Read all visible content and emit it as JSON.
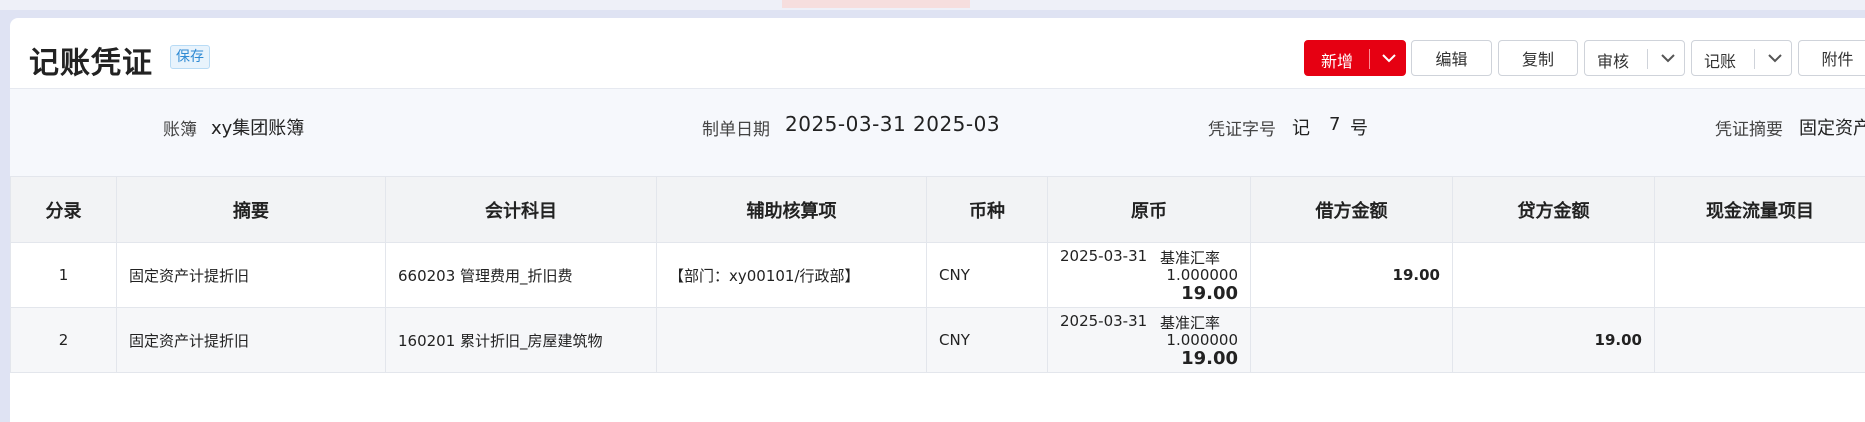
{
  "page": {
    "title": "记账凭证",
    "status_badge": "保存"
  },
  "toolbar": {
    "new_label": "新增",
    "edit_label": "编辑",
    "copy_label": "复制",
    "audit_label": "审核",
    "post_label": "记账",
    "attach_label": "附件",
    "primary_color": "#e60012"
  },
  "info": {
    "book_label": "账簿",
    "book_value": "xy集团账簿",
    "date_label": "制单日期",
    "date_value": "2025-03-31",
    "period_value": "2025-03",
    "voucher_label": "凭证字号",
    "voucher_word": "记",
    "voucher_no": "7",
    "voucher_suffix": "号",
    "summary_label": "凭证摘要",
    "summary_value": "固定资产"
  },
  "table": {
    "headers": [
      "分录",
      "摘要",
      "会计科目",
      "辅助核算项",
      "币种",
      "原币",
      "借方金额",
      "贷方金额",
      "现金流量项目"
    ],
    "rows": [
      {
        "no": "1",
        "summary": "固定资产计提折旧",
        "account": "660203 管理费用_折旧费",
        "aux": "【部门：xy00101/行政部】",
        "currency": "CNY",
        "orig_date": "2025-03-31",
        "orig_rate_label": "基准汇率",
        "orig_rate": "1.000000",
        "orig_amount": "19.00",
        "debit": "19.00",
        "credit": "",
        "cashflow": ""
      },
      {
        "no": "2",
        "summary": "固定资产计提折旧",
        "account": "160201 累计折旧_房屋建筑物",
        "aux": "",
        "currency": "CNY",
        "orig_date": "2025-03-31",
        "orig_rate_label": "基准汇率",
        "orig_rate": "1.000000",
        "orig_amount": "19.00",
        "debit": "",
        "credit": "19.00",
        "cashflow": ""
      }
    ]
  }
}
